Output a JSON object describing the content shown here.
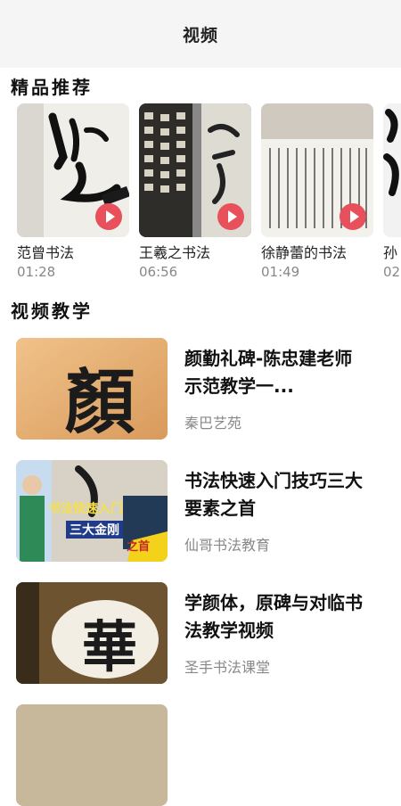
{
  "header": {
    "title": "视频"
  },
  "featured": {
    "section_title": "精品推荐",
    "items": [
      {
        "name": "范曾书法",
        "duration": "01:28"
      },
      {
        "name": "王羲之书法",
        "duration": "06:56"
      },
      {
        "name": "徐静蕾的书法",
        "duration": "01:49"
      },
      {
        "name": "孙",
        "duration": "02"
      }
    ]
  },
  "teaching": {
    "section_title": "视频教学",
    "items": [
      {
        "title": "颜勤礼碑-陈忠建老师示范教学一...",
        "source": "秦巴艺苑",
        "thumb_char": "顏"
      },
      {
        "title": "书法快速入门技巧三大要素之首",
        "source": "仙哥书法教育",
        "thumb_banner": "书法快速入门",
        "thumb_subtitle": "三大金刚",
        "thumb_badge": "之首"
      },
      {
        "title": "学颜体，原碑与对临书法教学视频",
        "source": "圣手书法课堂",
        "thumb_char": "華"
      },
      {
        "title": "",
        "source": ""
      }
    ]
  }
}
